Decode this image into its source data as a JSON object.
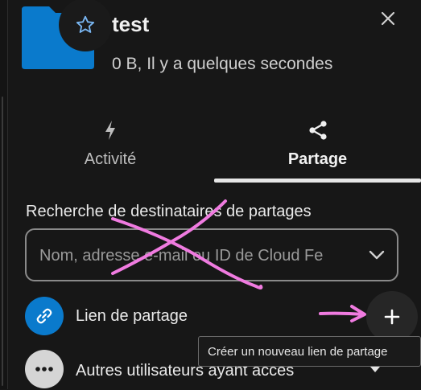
{
  "header": {
    "title": "test",
    "meta": "0 B, Il y a quelques secondes",
    "favorite_icon": "star-icon",
    "close_icon": "close-icon",
    "folder_color": "#0a7acc"
  },
  "tabs": [
    {
      "label": "Activité",
      "icon": "lightning-icon",
      "active": false
    },
    {
      "label": "Partage",
      "icon": "share-icon",
      "active": true
    }
  ],
  "sharing": {
    "search_label": "Recherche de destinataires de partages",
    "search_placeholder": "Nom, adresse e-mail ou ID de Cloud Fe",
    "share_link_label": "Lien de partage",
    "share_link_icon": "link-icon",
    "add_link_icon": "plus-icon",
    "add_link_tooltip": "Créer un nouveau lien de partage",
    "others_label": "Autres utilisateurs ayant accès",
    "others_icon": "more-icon"
  },
  "colors": {
    "background": "#171717",
    "accent": "#0a7acc",
    "annotation": "#f07be0"
  }
}
